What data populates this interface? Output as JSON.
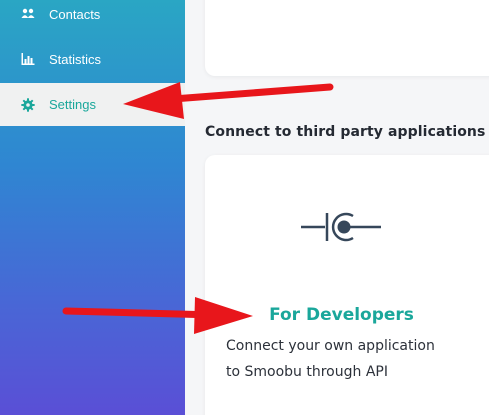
{
  "sidebar": {
    "items": [
      {
        "label": "Contacts",
        "icon": "contacts-icon",
        "active": false
      },
      {
        "label": "Statistics",
        "icon": "bar-chart-icon",
        "active": false
      },
      {
        "label": "Settings",
        "icon": "gear-icon",
        "active": true
      }
    ]
  },
  "main": {
    "section_heading": "Connect to third party applications",
    "developer_card": {
      "icon": "api-connector-icon",
      "title": "For Developers",
      "description_line1": "Connect your own application",
      "description_line2": "to Smoobu through API"
    }
  },
  "colors": {
    "accent": "#1aa79b",
    "sidebar_top": "#2aa6c4",
    "sidebar_bottom": "#5a4fd6",
    "annotation": "#e8161b",
    "icon": "#36475a"
  }
}
